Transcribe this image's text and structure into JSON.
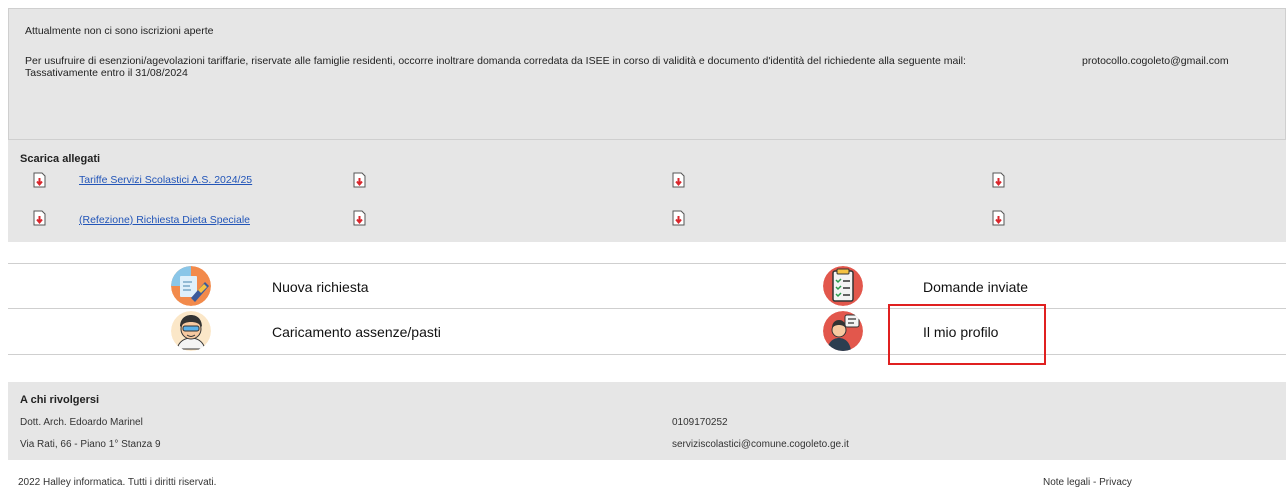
{
  "notice": {
    "line1": "Attualmente non ci sono iscrizioni aperte",
    "line2": "Per usufruire di esenzioni/agevolazioni tariffarie, riservate alle famiglie residenti, occorre inoltrare domanda corredata da ISEE in corso di validità e documento d'identità del richiedente alla seguente mail:",
    "mail": "protocollo.cogoleto@gmail.com",
    "line3": "Tassativamente entro il 31/08/2024"
  },
  "allegati": {
    "title": "Scarica allegati",
    "links": [
      {
        "label": "Tariffe Servizi Scolastici A.S. 2024/25"
      },
      {
        "label": "(Refezione) Richiesta Dieta Speciale"
      }
    ]
  },
  "menu": {
    "nuova_richiesta": "Nuova richiesta",
    "domande_inviate": "Domande inviate",
    "caricamento": "Caricamento assenze/pasti",
    "profilo": "Il mio profilo"
  },
  "contact": {
    "title": "A chi rivolgersi",
    "name": "Dott. Arch. Edoardo Marinel",
    "address": "Via Rati, 66 - Piano 1° Stanza 9",
    "phone": "0109170252",
    "email": "serviziscolastici@comune.cogoleto.ge.it"
  },
  "footer": {
    "copyright": "2022 Halley informatica. Tutti i diritti riservati.",
    "legal": "Note legali - Privacy"
  },
  "colors": {
    "panel": "#e6e6e6",
    "link": "#2255b8",
    "highlight": "#e02020",
    "download_arrow": "#d9262c"
  }
}
